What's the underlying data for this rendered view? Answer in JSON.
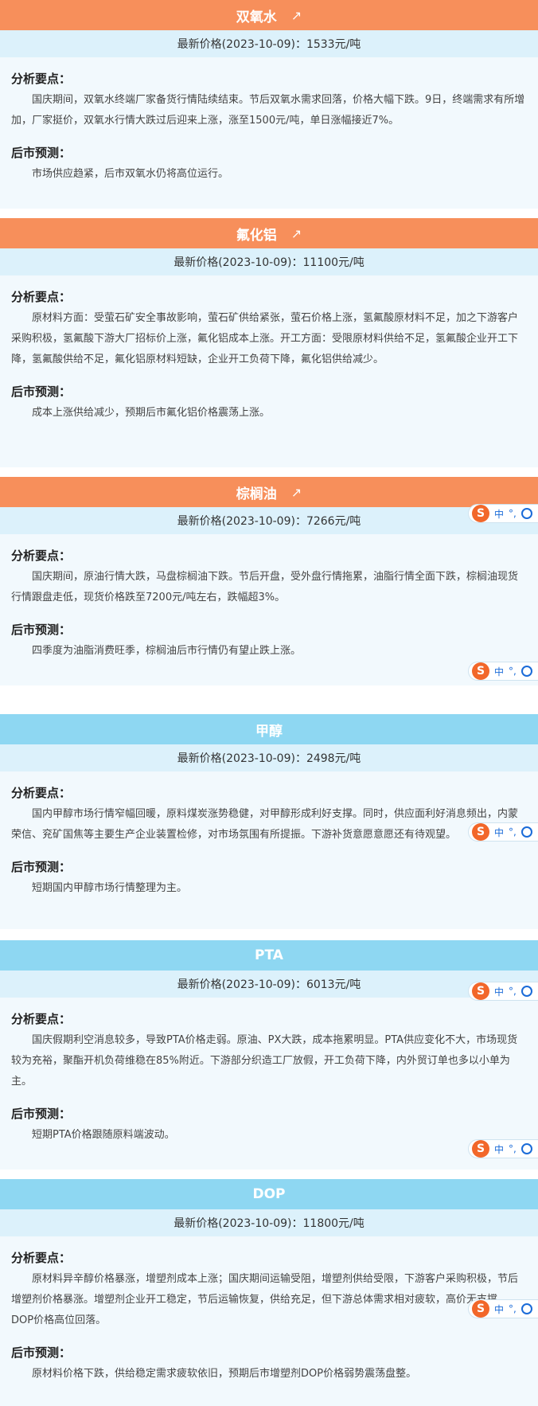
{
  "labels": {
    "analysis": "分析要点：",
    "forecast": "后市预测：",
    "arrow": "↗"
  },
  "ime_toolbar": {
    "logo": "S",
    "mode": "中",
    "punct": "°,",
    "emoji_icon": "smile-icon"
  },
  "colors": {
    "orange_header": "#f78f5b",
    "blue_header": "#8ed7f2",
    "price_bar": "#dcf1fb",
    "card_bg": "#f2f9fd"
  },
  "products": [
    {
      "name": "双氧水",
      "header_color": "orange",
      "trend_icon": "arrow-up-right-icon",
      "price": "最新价格(2023-10-09)：1533元/吨",
      "analysis": "国庆期间，双氧水终端厂家备货行情陆续结束。节后双氧水需求回落，价格大幅下跌。9日，终端需求有所增加，厂家挺价，双氧水行情大跌过后迎来上涨，涨至1500元/吨，单日涨幅接近7%。",
      "forecast": "市场供应趋紧，后市双氧水仍将高位运行。"
    },
    {
      "name": "氟化铝",
      "header_color": "orange",
      "trend_icon": "arrow-up-right-icon",
      "price": "最新价格(2023-10-09)：11100元/吨",
      "analysis": "原材料方面：受萤石矿安全事故影响，萤石矿供给紧张，萤石价格上涨，氢氟酸原材料不足，加之下游客户采购积极，氢氟酸下游大厂招标价上涨，氟化铝成本上涨。开工方面：受限原材料供给不足，氢氟酸企业开工下降，氢氟酸供给不足，氟化铝原材料短缺，企业开工负荷下降，氟化铝供给减少。",
      "forecast": "成本上涨供给减少，预期后市氟化铝价格震荡上涨。"
    },
    {
      "name": "棕榈油",
      "header_color": "orange",
      "trend_icon": "arrow-up-right-icon",
      "price": "最新价格(2023-10-09)：7266元/吨",
      "analysis": "国庆期间，原油行情大跌，马盘棕榈油下跌。节后开盘，受外盘行情拖累，油脂行情全面下跌，棕榈油现货行情跟盘走低，现货价格跌至7200元/吨左右，跌幅超3%。",
      "forecast": "四季度为油脂消费旺季，棕榈油后市行情仍有望止跌上涨。"
    },
    {
      "name": "甲醇",
      "header_color": "blue",
      "trend_icon": "",
      "price": "最新价格(2023-10-09)：2498元/吨",
      "analysis": "国内甲醇市场行情窄幅回暖，原料煤炭涨势稳健，对甲醇形成利好支撑。同时，供应面利好消息频出，内蒙荣信、兖矿国焦等主要生产企业装置检修，对市场氛围有所提振。下游补货意愿意愿还有待观望。",
      "forecast": "短期国内甲醇市场行情整理为主。"
    },
    {
      "name": "PTA",
      "header_color": "blue",
      "trend_icon": "",
      "price": "最新价格(2023-10-09)：6013元/吨",
      "analysis": "国庆假期利空消息较多，导致PTA价格走弱。原油、PX大跌，成本拖累明显。PTA供应变化不大，市场现货较为充裕，聚酯开机负荷维稳在85%附近。下游部分织造工厂放假，开工负荷下降，内外贸订单也多以小单为主。",
      "forecast": "短期PTA价格跟随原料端波动。"
    },
    {
      "name": "DOP",
      "header_color": "blue",
      "trend_icon": "",
      "price": "最新价格(2023-10-09)：11800元/吨",
      "analysis": "原材料异辛醇价格暴涨，增塑剂成本上涨；国庆期间运输受阻，增塑剂供给受限，下游客户采购积极，节后增塑剂价格暴涨。增塑剂企业开工稳定，节后运输恢复，供给充足，但下游总体需求相对疲软，高价无支撑，DOP价格高位回落。",
      "forecast": "原材料价格下跌，供给稳定需求疲软依旧，预期后市增塑剂DOP价格弱势震荡盘整。"
    }
  ]
}
